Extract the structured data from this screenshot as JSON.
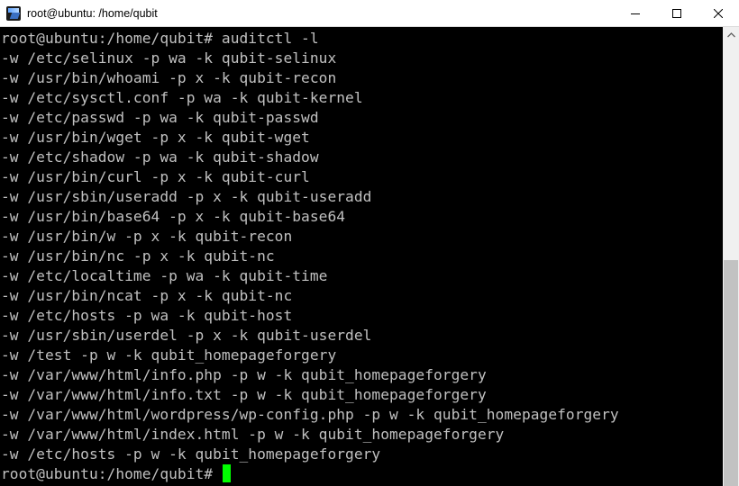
{
  "window": {
    "title": "root@ubuntu: /home/qubit",
    "icon": "putty-terminal-icon",
    "controls": {
      "minimize": "minimize-icon",
      "maximize": "maximize-icon",
      "close": "close-icon"
    }
  },
  "terminal": {
    "colors": {
      "background": "#000000",
      "text": "#c0c0c0",
      "cursor": "#00ff00"
    },
    "lines": [
      "root@ubuntu:/home/qubit# auditctl -l",
      "-w /etc/selinux -p wa -k qubit-selinux",
      "-w /usr/bin/whoami -p x -k qubit-recon",
      "-w /etc/sysctl.conf -p wa -k qubit-kernel",
      "-w /etc/passwd -p wa -k qubit-passwd",
      "-w /usr/bin/wget -p x -k qubit-wget",
      "-w /etc/shadow -p wa -k qubit-shadow",
      "-w /usr/bin/curl -p x -k qubit-curl",
      "-w /usr/sbin/useradd -p x -k qubit-useradd",
      "-w /usr/bin/base64 -p x -k qubit-base64",
      "-w /usr/bin/w -p x -k qubit-recon",
      "-w /usr/bin/nc -p x -k qubit-nc",
      "-w /etc/localtime -p wa -k qubit-time",
      "-w /usr/bin/ncat -p x -k qubit-nc",
      "-w /etc/hosts -p wa -k qubit-host",
      "-w /usr/sbin/userdel -p x -k qubit-userdel",
      "-w /test -p w -k qubit_homepageforgery",
      "-w /var/www/html/info.php -p w -k qubit_homepageforgery",
      "-w /var/www/html/info.txt -p w -k qubit_homepageforgery",
      "-w /var/www/html/wordpress/wp-config.php -p w -k qubit_homepageforgery",
      "-w /var/www/html/index.html -p w -k qubit_homepageforgery",
      "-w /etc/hosts -p w -k qubit_homepageforgery"
    ],
    "prompt": "root@ubuntu:/home/qubit# "
  }
}
